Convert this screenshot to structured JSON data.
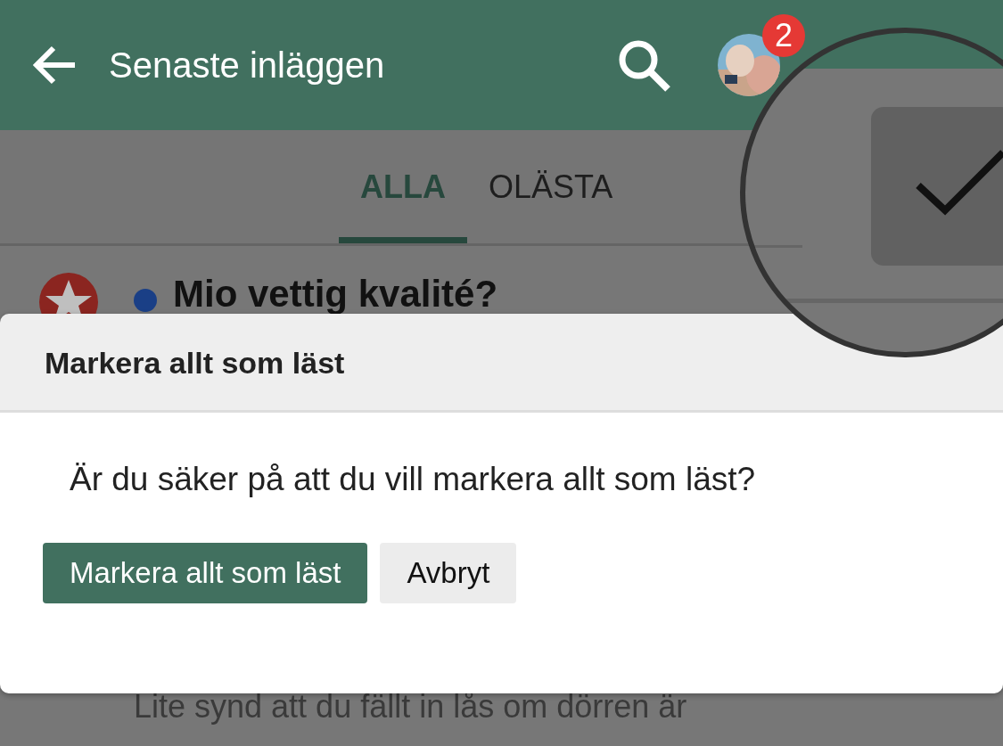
{
  "header": {
    "title": "Senaste inläggen",
    "notification_count": "2"
  },
  "tabs": [
    {
      "label": "ALLA",
      "selected": true
    },
    {
      "label": "OLÄSTA",
      "selected": false
    }
  ],
  "posts": [
    {
      "title": "Mio vettig kvalité?",
      "unread": true,
      "excerpt": "Lite synd att du fällt in lås om dörren är"
    }
  ],
  "dialog": {
    "title": "Markera allt som läst",
    "message": "Är du säker på att du vill markera allt som läst?",
    "buttons": [
      {
        "label": "Markera allt som läst",
        "kind": "primary"
      },
      {
        "label": "Avbryt",
        "kind": "secondary"
      }
    ]
  }
}
